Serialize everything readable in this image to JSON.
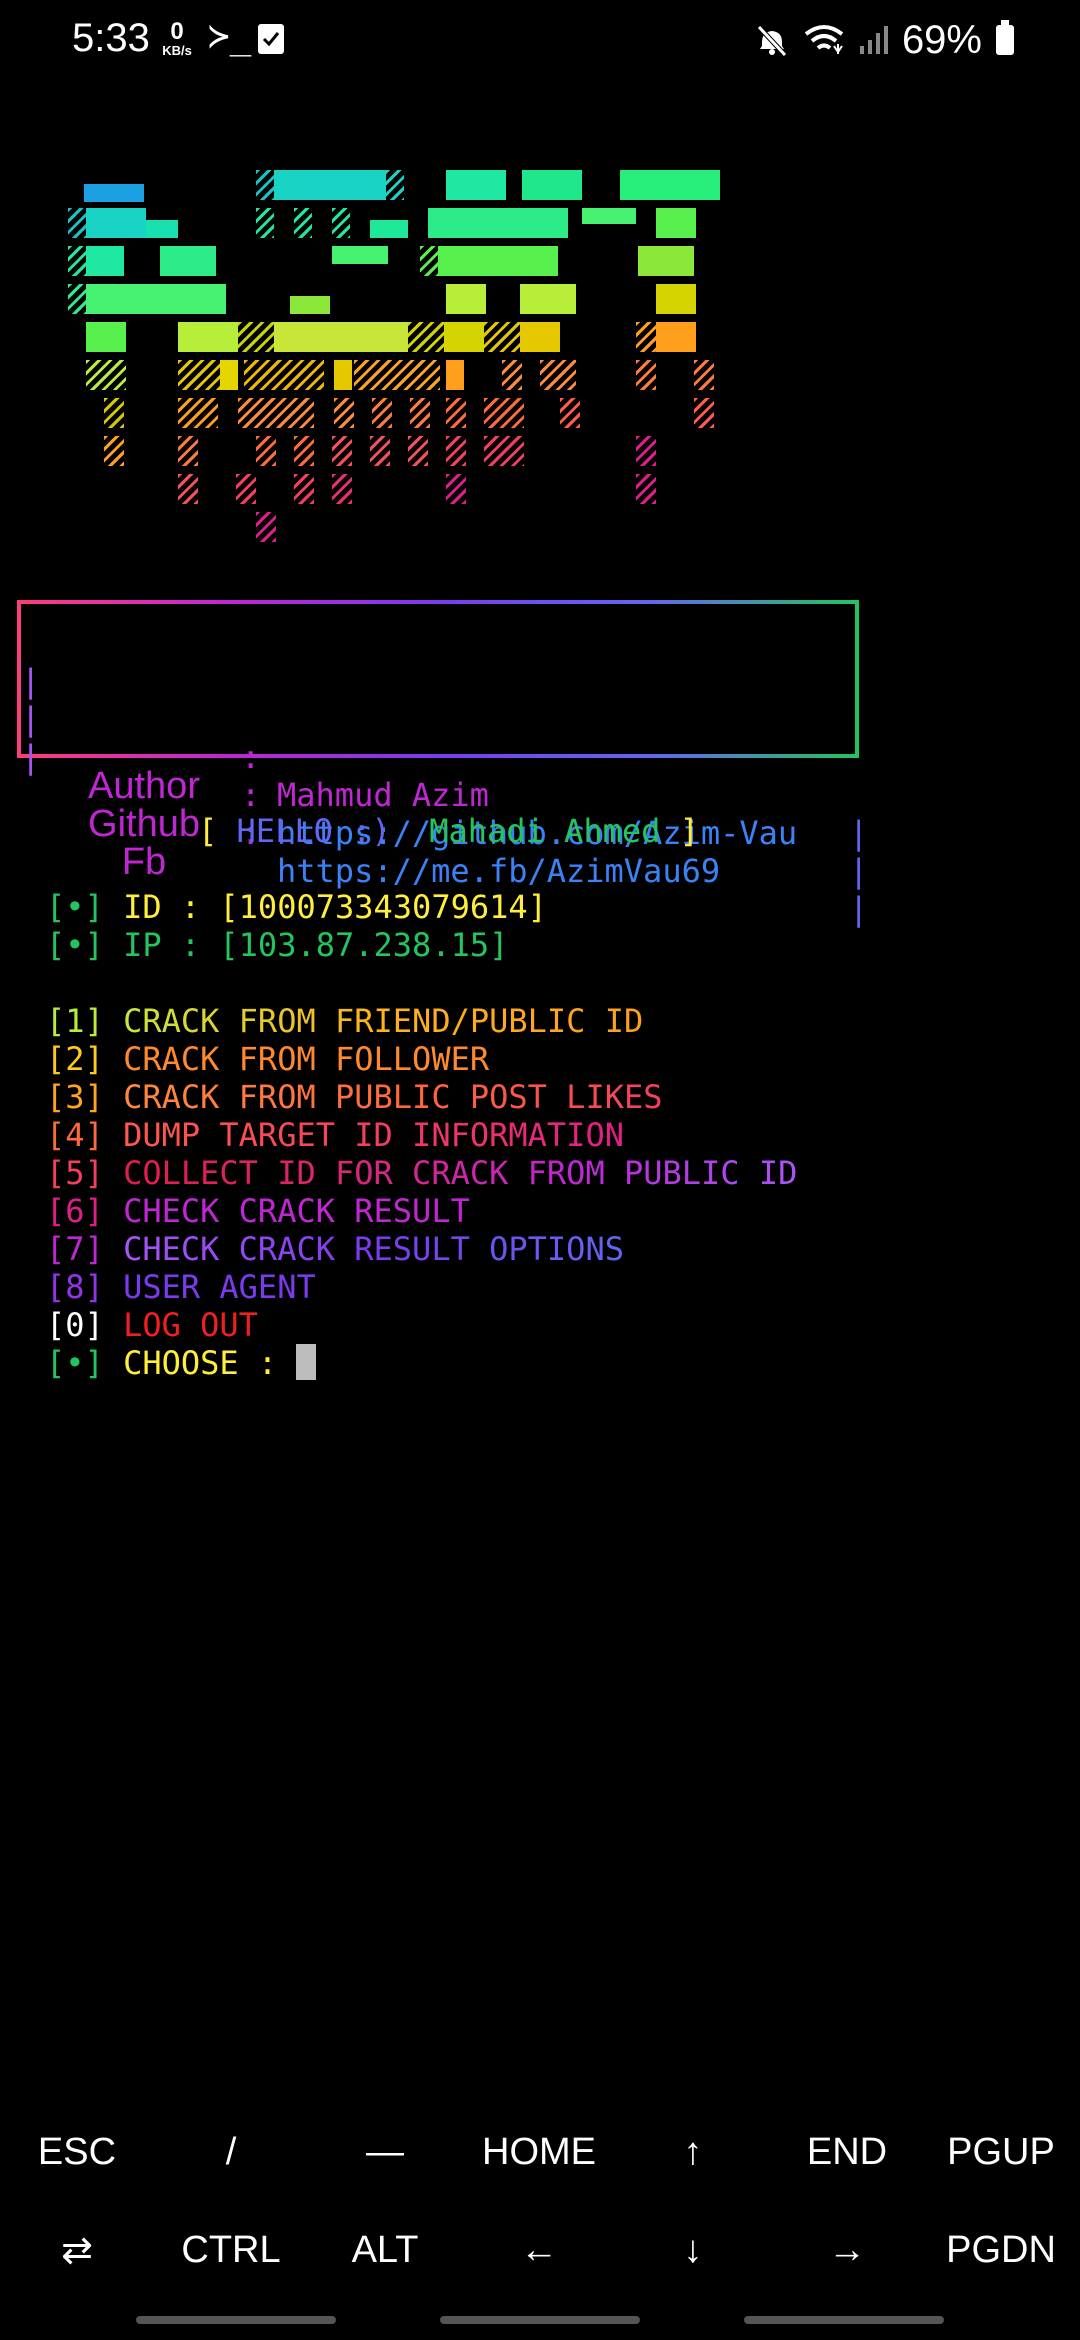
{
  "status_bar": {
    "time": "5:33",
    "net_speed_value": "0",
    "net_speed_unit": "KB/s",
    "terminal_glyph": "≻_",
    "battery": "69%",
    "icons": [
      "terminal-icon",
      "checkbox-notification-icon",
      "mute-icon",
      "wifi-icon",
      "signal-icon",
      "battery-icon"
    ]
  },
  "banner": {
    "description_colors": [
      "#1ba1e2",
      "#19d3c5",
      "#1ee88a",
      "#58f04c",
      "#b7ee3a",
      "#f4d000",
      "#ff9f1c",
      "#ff6a3d",
      "#f43f5e",
      "#e11d8a"
    ]
  },
  "info": {
    "rows": [
      {
        "key": "Author",
        "colon": ":",
        "value": "Mahmud Azim",
        "value_color": "#c026d3"
      },
      {
        "key": "Github",
        "colon": ":",
        "value": "https://github.com/Azim-Vau",
        "value_color": "#3b82f6"
      },
      {
        "key": "Fb",
        "colon": ":",
        "value": "https://me.fb/AzimVau69",
        "value_color": "#3b82f6"
      }
    ],
    "bar": "|"
  },
  "hello": {
    "open": "[",
    "greeting": "HELLO :)",
    "name": "Mahadi Ahmed",
    "close": "]"
  },
  "account": {
    "bullet": "[•]",
    "id_line": "ID : [100073343079614]",
    "ip_line": "IP : [103.87.238.15]"
  },
  "menu": [
    {
      "num": "[1]",
      "label": "CRACK FROM FRIEND/PUBLIC ID"
    },
    {
      "num": "[2]",
      "label": "CRACK FROM FOLLOWER"
    },
    {
      "num": "[3]",
      "label": "CRACK FROM PUBLIC POST LIKES"
    },
    {
      "num": "[4]",
      "label": "DUMP TARGET ID INFORMATION"
    },
    {
      "num": "[5]",
      "label": "COLLECT ID FOR CRACK FROM PUBLIC ID"
    },
    {
      "num": "[6]",
      "label": "CHECK CRACK RESULT"
    },
    {
      "num": "[7]",
      "label": "CHECK CRACK RESULT OPTIONS"
    },
    {
      "num": "[8]",
      "label": "USER AGENT"
    },
    {
      "num": "[0]",
      "label": "LOG OUT"
    }
  ],
  "prompt": {
    "bullet": "[•]",
    "label": "CHOOSE :"
  },
  "extra_keys": {
    "row1": [
      "ESC",
      "/",
      "—",
      "HOME",
      "↑",
      "END",
      "PGUP"
    ],
    "row2": [
      "⇄",
      "CTRL",
      "ALT",
      "←",
      "↓",
      "→",
      "PGDN"
    ]
  }
}
